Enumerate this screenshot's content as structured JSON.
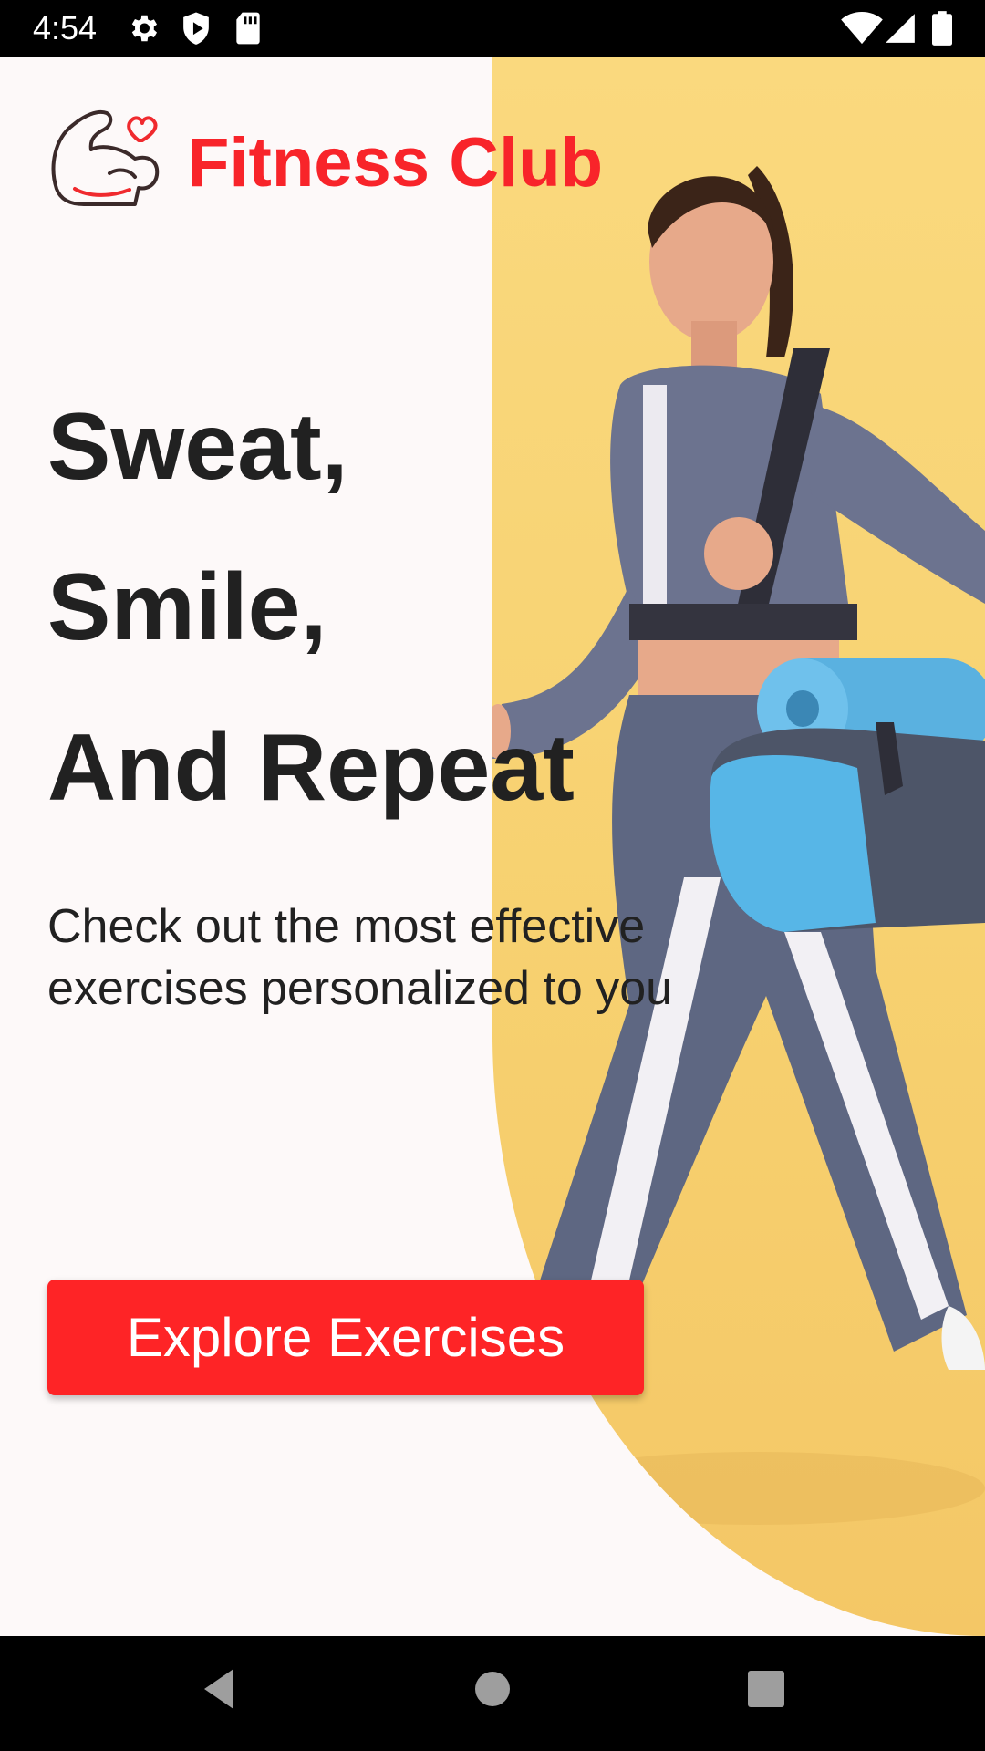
{
  "status_bar": {
    "time": "4:54",
    "left_icons": [
      "gear-icon",
      "shield-play-icon",
      "sd-card-icon"
    ],
    "right_icons": [
      "wifi-icon",
      "signal-icon",
      "battery-icon"
    ]
  },
  "header": {
    "logo_icon": "flexed-arm-heart-icon",
    "brand": "Fitness Club"
  },
  "hero": {
    "headline_lines": [
      "Sweat,",
      "Smile,",
      "And Repeat"
    ],
    "subtitle_lines": [
      "Check out the most effective",
      "exercises personalized to you"
    ],
    "image": "woman-with-gym-bag-and-yoga-mat-photo"
  },
  "cta": {
    "label": "Explore Exercises"
  },
  "nav_bar": {
    "back": "back-triangle-icon",
    "home": "home-circle-icon",
    "recents": "recents-square-icon"
  },
  "colors": {
    "accent": "#fe2426",
    "brand_text": "#f8242a",
    "heading": "#212121",
    "hero_bg": "#f7d170",
    "page_bg": "#fdf9f9"
  }
}
